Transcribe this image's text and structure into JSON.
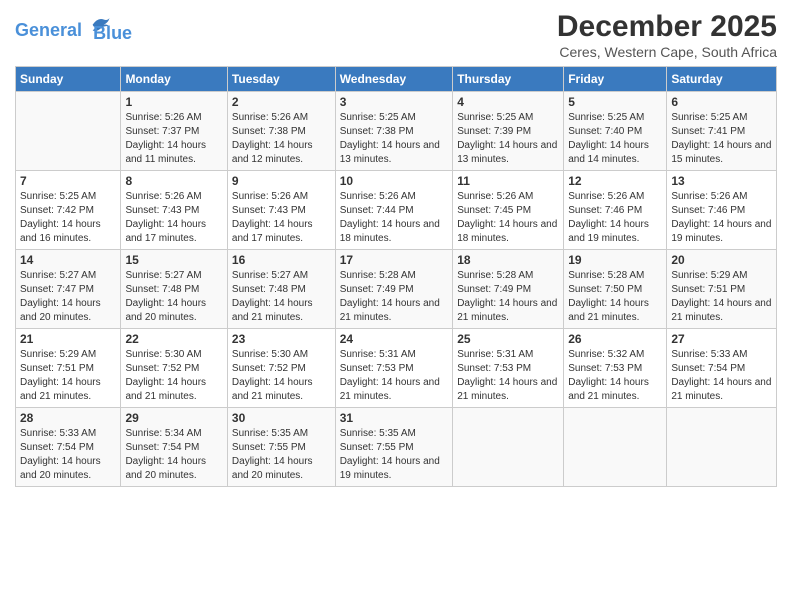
{
  "logo": {
    "line1": "General",
    "line2": "Blue"
  },
  "title": "December 2025",
  "subtitle": "Ceres, Western Cape, South Africa",
  "days_header": [
    "Sunday",
    "Monday",
    "Tuesday",
    "Wednesday",
    "Thursday",
    "Friday",
    "Saturday"
  ],
  "weeks": [
    [
      {
        "day": "",
        "empty": true
      },
      {
        "day": "1",
        "sunrise": "5:26 AM",
        "sunset": "7:37 PM",
        "daylight": "14 hours and 11 minutes."
      },
      {
        "day": "2",
        "sunrise": "5:26 AM",
        "sunset": "7:38 PM",
        "daylight": "14 hours and 12 minutes."
      },
      {
        "day": "3",
        "sunrise": "5:25 AM",
        "sunset": "7:38 PM",
        "daylight": "14 hours and 13 minutes."
      },
      {
        "day": "4",
        "sunrise": "5:25 AM",
        "sunset": "7:39 PM",
        "daylight": "14 hours and 13 minutes."
      },
      {
        "day": "5",
        "sunrise": "5:25 AM",
        "sunset": "7:40 PM",
        "daylight": "14 hours and 14 minutes."
      },
      {
        "day": "6",
        "sunrise": "5:25 AM",
        "sunset": "7:41 PM",
        "daylight": "14 hours and 15 minutes."
      }
    ],
    [
      {
        "day": "7",
        "sunrise": "5:25 AM",
        "sunset": "7:42 PM",
        "daylight": "14 hours and 16 minutes."
      },
      {
        "day": "8",
        "sunrise": "5:26 AM",
        "sunset": "7:43 PM",
        "daylight": "14 hours and 17 minutes."
      },
      {
        "day": "9",
        "sunrise": "5:26 AM",
        "sunset": "7:43 PM",
        "daylight": "14 hours and 17 minutes."
      },
      {
        "day": "10",
        "sunrise": "5:26 AM",
        "sunset": "7:44 PM",
        "daylight": "14 hours and 18 minutes."
      },
      {
        "day": "11",
        "sunrise": "5:26 AM",
        "sunset": "7:45 PM",
        "daylight": "14 hours and 18 minutes."
      },
      {
        "day": "12",
        "sunrise": "5:26 AM",
        "sunset": "7:46 PM",
        "daylight": "14 hours and 19 minutes."
      },
      {
        "day": "13",
        "sunrise": "5:26 AM",
        "sunset": "7:46 PM",
        "daylight": "14 hours and 19 minutes."
      }
    ],
    [
      {
        "day": "14",
        "sunrise": "5:27 AM",
        "sunset": "7:47 PM",
        "daylight": "14 hours and 20 minutes."
      },
      {
        "day": "15",
        "sunrise": "5:27 AM",
        "sunset": "7:48 PM",
        "daylight": "14 hours and 20 minutes."
      },
      {
        "day": "16",
        "sunrise": "5:27 AM",
        "sunset": "7:48 PM",
        "daylight": "14 hours and 21 minutes."
      },
      {
        "day": "17",
        "sunrise": "5:28 AM",
        "sunset": "7:49 PM",
        "daylight": "14 hours and 21 minutes."
      },
      {
        "day": "18",
        "sunrise": "5:28 AM",
        "sunset": "7:49 PM",
        "daylight": "14 hours and 21 minutes."
      },
      {
        "day": "19",
        "sunrise": "5:28 AM",
        "sunset": "7:50 PM",
        "daylight": "14 hours and 21 minutes."
      },
      {
        "day": "20",
        "sunrise": "5:29 AM",
        "sunset": "7:51 PM",
        "daylight": "14 hours and 21 minutes."
      }
    ],
    [
      {
        "day": "21",
        "sunrise": "5:29 AM",
        "sunset": "7:51 PM",
        "daylight": "14 hours and 21 minutes."
      },
      {
        "day": "22",
        "sunrise": "5:30 AM",
        "sunset": "7:52 PM",
        "daylight": "14 hours and 21 minutes."
      },
      {
        "day": "23",
        "sunrise": "5:30 AM",
        "sunset": "7:52 PM",
        "daylight": "14 hours and 21 minutes."
      },
      {
        "day": "24",
        "sunrise": "5:31 AM",
        "sunset": "7:53 PM",
        "daylight": "14 hours and 21 minutes."
      },
      {
        "day": "25",
        "sunrise": "5:31 AM",
        "sunset": "7:53 PM",
        "daylight": "14 hours and 21 minutes."
      },
      {
        "day": "26",
        "sunrise": "5:32 AM",
        "sunset": "7:53 PM",
        "daylight": "14 hours and 21 minutes."
      },
      {
        "day": "27",
        "sunrise": "5:33 AM",
        "sunset": "7:54 PM",
        "daylight": "14 hours and 21 minutes."
      }
    ],
    [
      {
        "day": "28",
        "sunrise": "5:33 AM",
        "sunset": "7:54 PM",
        "daylight": "14 hours and 20 minutes."
      },
      {
        "day": "29",
        "sunrise": "5:34 AM",
        "sunset": "7:54 PM",
        "daylight": "14 hours and 20 minutes."
      },
      {
        "day": "30",
        "sunrise": "5:35 AM",
        "sunset": "7:55 PM",
        "daylight": "14 hours and 20 minutes."
      },
      {
        "day": "31",
        "sunrise": "5:35 AM",
        "sunset": "7:55 PM",
        "daylight": "14 hours and 19 minutes."
      },
      {
        "day": "",
        "empty": true
      },
      {
        "day": "",
        "empty": true
      },
      {
        "day": "",
        "empty": true
      }
    ]
  ]
}
